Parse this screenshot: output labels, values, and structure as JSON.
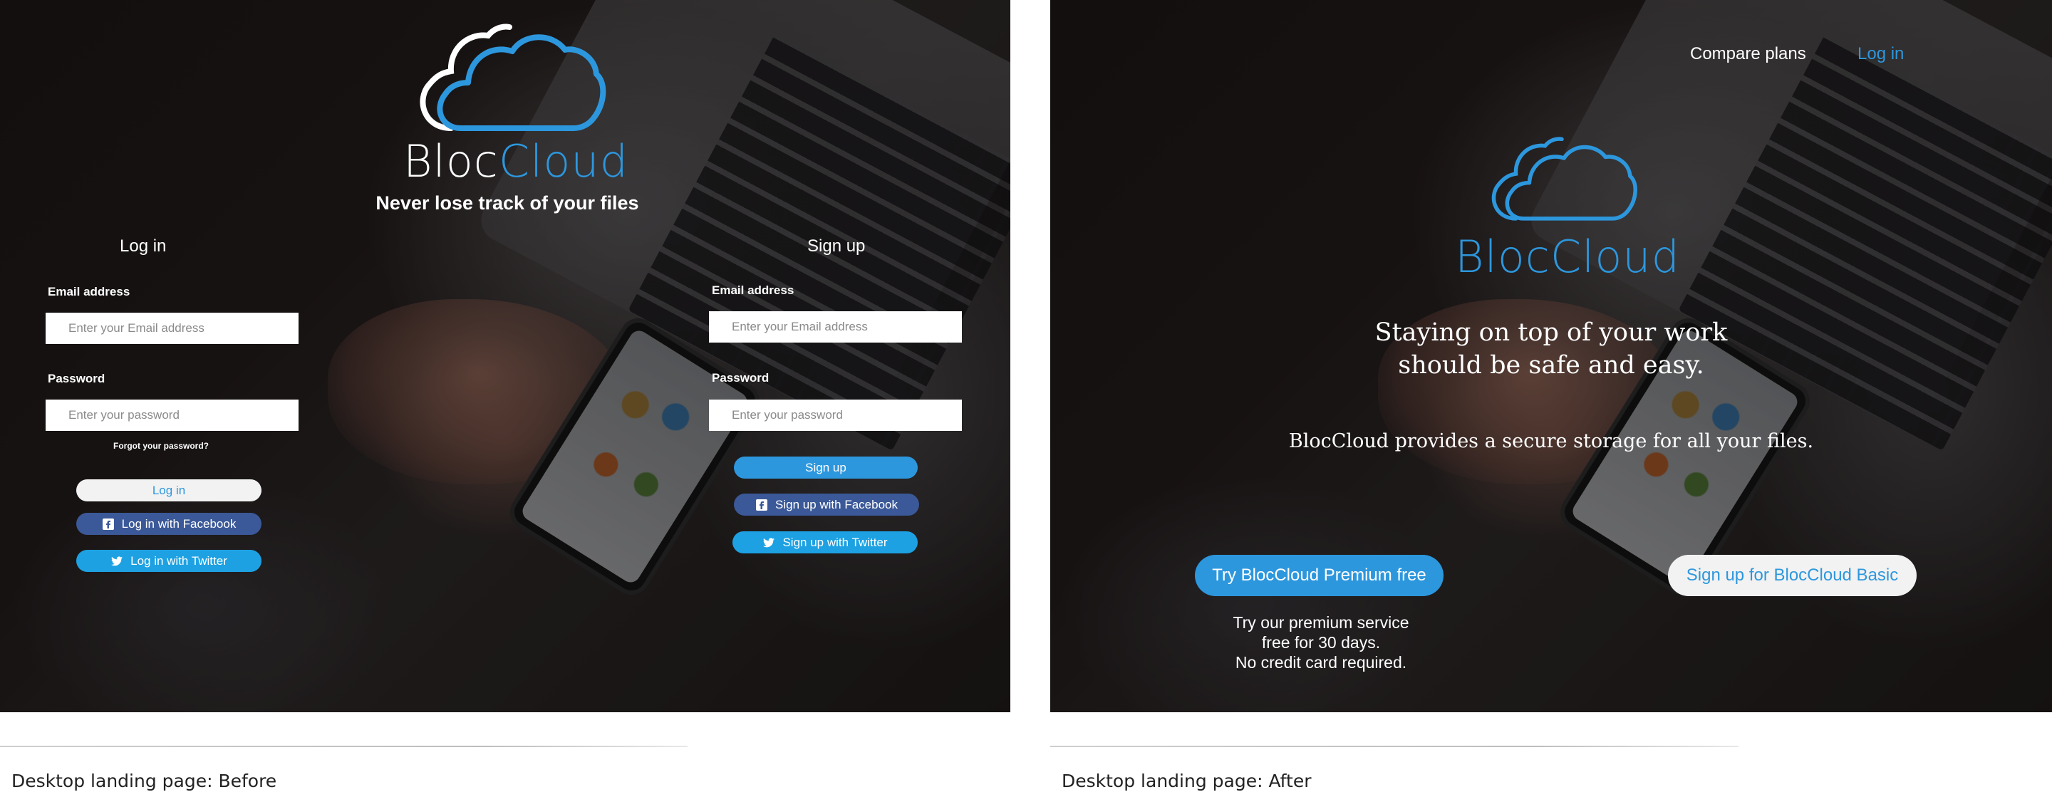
{
  "before": {
    "logo": {
      "part1": "Bloc",
      "part2": "Cloud"
    },
    "tagline": "Never lose track of your files",
    "login": {
      "title": "Log in",
      "email_label": "Email address",
      "email_placeholder": "Enter your Email address",
      "password_label": "Password",
      "password_placeholder": "Enter your password",
      "forgot": "Forgot your password?",
      "login_button": "Log in",
      "facebook_button": "Log in with Facebook",
      "twitter_button": "Log in with Twitter"
    },
    "signup": {
      "title": "Sign up",
      "email_label": "Email address",
      "email_placeholder": "Enter your Email address",
      "password_label": "Password",
      "password_placeholder": "Enter your password",
      "signup_button": "Sign up",
      "facebook_button": "Sign up with Facebook",
      "twitter_button": "Sign up with Twitter"
    }
  },
  "after": {
    "nav": {
      "compare": "Compare plans",
      "login": "Log in"
    },
    "logo": {
      "part1": "Bloc",
      "part2": "Cloud"
    },
    "headline_line1": "Staying on top of your work",
    "headline_line2": "should be safe and easy.",
    "subline": "BlocCloud provides a secure storage for all your files.",
    "premium_button": "Try BlocCloud Premium free",
    "premium_note_line1": "Try our premium service",
    "premium_note_line2": "free for 30 days.",
    "premium_note_line3": "No credit card required.",
    "basic_button": "Sign up for BlocCloud Basic"
  },
  "captions": {
    "before": "Desktop landing page: Before",
    "after": "Desktop landing page: After"
  },
  "colors": {
    "brand_blue": "#2d97dd",
    "facebook_blue": "#3b5998",
    "twitter_blue": "#1da1e2",
    "light_button": "#f2f2f2",
    "icons": [
      "cloud-icon",
      "facebook-icon",
      "twitter-icon"
    ]
  }
}
